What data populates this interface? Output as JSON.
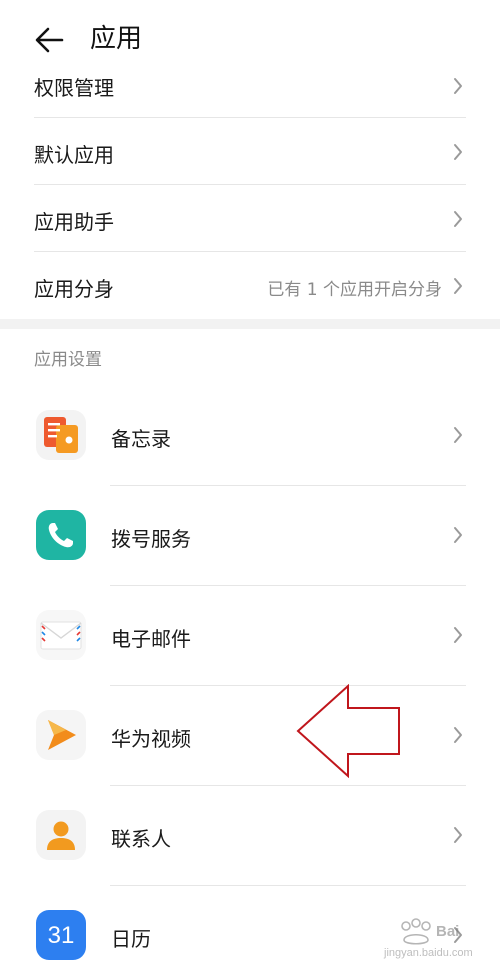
{
  "header": {
    "title": "应用",
    "back_icon": "back-arrow-icon"
  },
  "top_items": [
    {
      "label": "权限管理"
    },
    {
      "label": "默认应用"
    },
    {
      "label": "应用助手"
    },
    {
      "label": "应用分身",
      "value": "已有 1 个应用开启分身"
    }
  ],
  "section": {
    "title": "应用设置"
  },
  "apps": [
    {
      "label": "备忘录",
      "icon": "notepad-icon"
    },
    {
      "label": "拨号服务",
      "icon": "phone-icon"
    },
    {
      "label": "电子邮件",
      "icon": "email-icon"
    },
    {
      "label": "华为视频",
      "icon": "video-play-icon"
    },
    {
      "label": "联系人",
      "icon": "contacts-icon"
    },
    {
      "label": "日历",
      "icon": "calendar-icon",
      "icon_text": "31"
    }
  ],
  "colors": {
    "accent_arrow": "#c0161c"
  },
  "watermark": {
    "text": "jingyan.baidu.com"
  }
}
